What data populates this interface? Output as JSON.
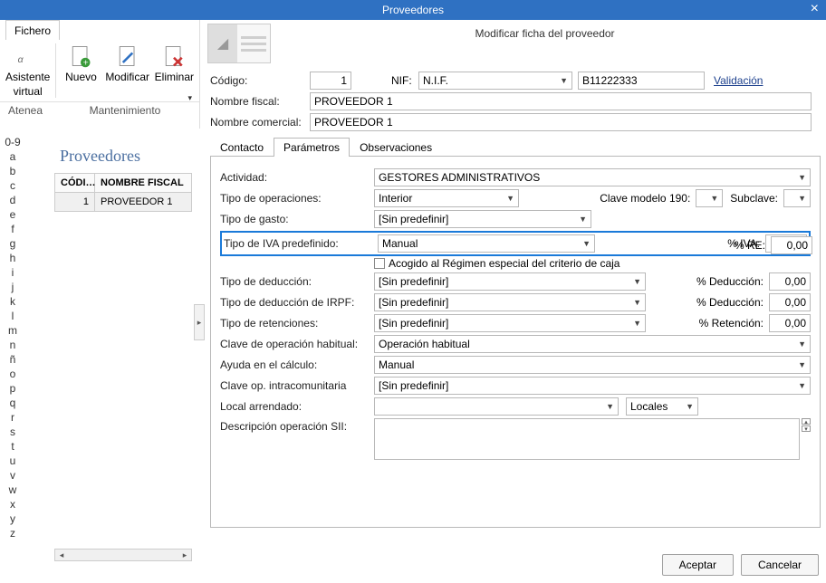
{
  "window": {
    "title": "Proveedores"
  },
  "ribbon": {
    "file_tab": "Fichero",
    "assistant": {
      "line1": "Asistente",
      "line2": "virtual",
      "caption": "Atenea"
    },
    "nuevo": "Nuevo",
    "modificar": "Modificar",
    "eliminar": "Eliminar",
    "group2": "Mantenimiento"
  },
  "supplier_panel_title": "Modificar ficha del proveedor",
  "alpha": [
    "0-9",
    "a",
    "b",
    "c",
    "d",
    "e",
    "f",
    "g",
    "h",
    "i",
    "j",
    "k",
    "l",
    "m",
    "n",
    "ñ",
    "o",
    "p",
    "q",
    "r",
    "s",
    "t",
    "u",
    "v",
    "w",
    "x",
    "y",
    "z"
  ],
  "grid": {
    "title": "Proveedores",
    "col1": "CÓDI…",
    "col2": "NOMBRE FISCAL",
    "rows": [
      {
        "code": "1",
        "name": "PROVEEDOR 1"
      }
    ]
  },
  "form": {
    "codigo_label": "Código:",
    "codigo_value": "1",
    "nif_label": "NIF:",
    "nif_type": "N.I.F.",
    "nif_value": "B11222333",
    "validacion": "Validación",
    "nombre_fiscal_label": "Nombre fiscal:",
    "nombre_fiscal_value": "PROVEEDOR 1",
    "nombre_comercial_label": "Nombre comercial:",
    "nombre_comercial_value": "PROVEEDOR 1"
  },
  "tabs": {
    "contacto": "Contacto",
    "parametros": "Parámetros",
    "observaciones": "Observaciones"
  },
  "params": {
    "actividad_label": "Actividad:",
    "actividad_value": "GESTORES ADMINISTRATIVOS",
    "tipo_op_label": "Tipo de operaciones:",
    "tipo_op_value": "Interior",
    "clave190_label": "Clave modelo 190:",
    "subclave_label": "Subclave:",
    "tipo_gasto_label": "Tipo de gasto:",
    "tipo_gasto_value": "[Sin predefinir]",
    "tipo_iva_label": "Tipo de IVA predefinido:",
    "tipo_iva_value": "Manual",
    "pct_iva_label": "% IVA:",
    "pct_iva_value": "0,00",
    "pct_re_label": "% RE:",
    "pct_re_value": "0,00",
    "acogido_label": "Acogido al Régimen especial del criterio de caja",
    "tipo_ded_label": "Tipo de deducción:",
    "tipo_ded_value": "[Sin predefinir]",
    "pct_ded_label": "% Deducción:",
    "pct_ded_value": "0,00",
    "tipo_ded_irpf_label": "Tipo de deducción de IRPF:",
    "tipo_ded_irpf_value": "[Sin predefinir]",
    "pct_ded2_label": "% Deducción:",
    "pct_ded2_value": "0,00",
    "tipo_ret_label": "Tipo de retenciones:",
    "tipo_ret_value": "[Sin predefinir]",
    "pct_ret_label": "% Retención:",
    "pct_ret_value": "0,00",
    "clave_op_label": "Clave de operación habitual:",
    "clave_op_value": "Operación habitual",
    "ayuda_label": "Ayuda en el cálculo:",
    "ayuda_value": "Manual",
    "clave_intra_label": "Clave op. intracomunitaria",
    "clave_intra_value": "[Sin predefinir]",
    "local_label": "Local arrendado:",
    "locales_btn": "Locales",
    "desc_sii_label": "Descripción operación SII:"
  },
  "buttons": {
    "accept": "Aceptar",
    "cancel": "Cancelar"
  }
}
